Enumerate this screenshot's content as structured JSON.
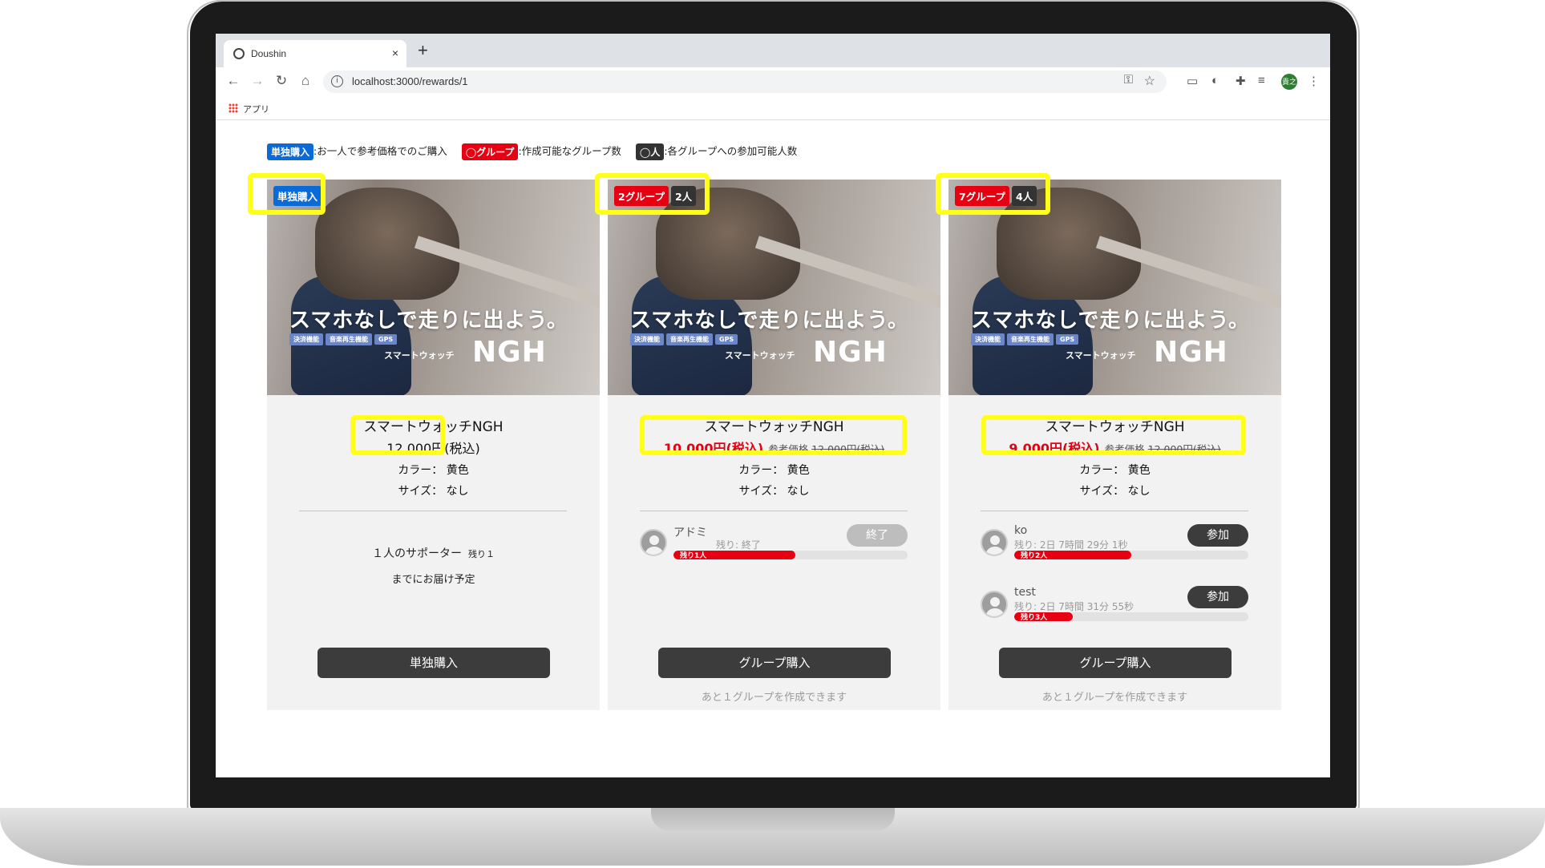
{
  "browser": {
    "tab_title": "Doushin",
    "tab_close": "×",
    "new_tab": "+",
    "url": "localhost:3000/rewards/1",
    "bookmarks_label": "アプリ",
    "avatar_text": "貴之",
    "nav_back": "←",
    "nav_forward": "→",
    "nav_reload": "↻",
    "nav_home": "⌂"
  },
  "legend": {
    "single_badge": "単独購入",
    "single_text": ":お一人で参考価格でのご購入",
    "group_badge": "◯グループ",
    "group_text": ":作成可能なグループ数",
    "people_badge": "◯人",
    "people_text": ":各グループへの参加可能人数"
  },
  "hero": {
    "headline": "スマホなしで走りに出よう。",
    "chips": [
      "決済機能",
      "音楽再生機能",
      "GPS"
    ],
    "sub": "スマートウォッチ",
    "logo": "NGH"
  },
  "cards": [
    {
      "tag": "単独購入",
      "name": "スマートウォッチNGH",
      "price": "12,000円(税込)",
      "color_line": "カラー： 黄色",
      "size_line": "サイズ： なし",
      "supporters": "１人のサポーター",
      "remaining": "残り１",
      "delivery": "までにお届け予定",
      "button": "単独購入"
    },
    {
      "tag_groups": "2グループ",
      "tag_people": "2人",
      "name": "スマートウォッチNGH",
      "price": "10,000円(税込)",
      "ref_label": "参考価格",
      "ref_price": "12,000円(税込)",
      "color_line": "カラー： 黄色",
      "size_line": "サイズ： なし",
      "groups": [
        {
          "name": "アドミ",
          "time": "残り: 終了",
          "bar_label": "残り1人",
          "progress": 0.52,
          "button": "終了"
        }
      ],
      "button": "グループ購入",
      "note": "あと１グループを作成できます"
    },
    {
      "tag_groups": "7グループ",
      "tag_people": "4人",
      "name": "スマートウォッチNGH",
      "price": "9,000円(税込)",
      "ref_label": "参考価格",
      "ref_price": "12,000円(税込)",
      "color_line": "カラー： 黄色",
      "size_line": "サイズ： なし",
      "groups": [
        {
          "name": "ko",
          "time": "残り: 2日 7時間 29分 1秒",
          "bar_label": "残り2人",
          "progress": 0.5,
          "button": "参加"
        },
        {
          "name": "test",
          "time": "残り: 2日 7時間 31分 55秒",
          "bar_label": "残り3人",
          "progress": 0.25,
          "button": "参加"
        }
      ],
      "button": "グループ購入",
      "note": "あと１グループを作成できます"
    }
  ],
  "colors": {
    "accent_red": "#e60012",
    "accent_blue": "#0a6ad8",
    "highlight": "#ffff1a",
    "button_dark": "#3c3c3c"
  }
}
